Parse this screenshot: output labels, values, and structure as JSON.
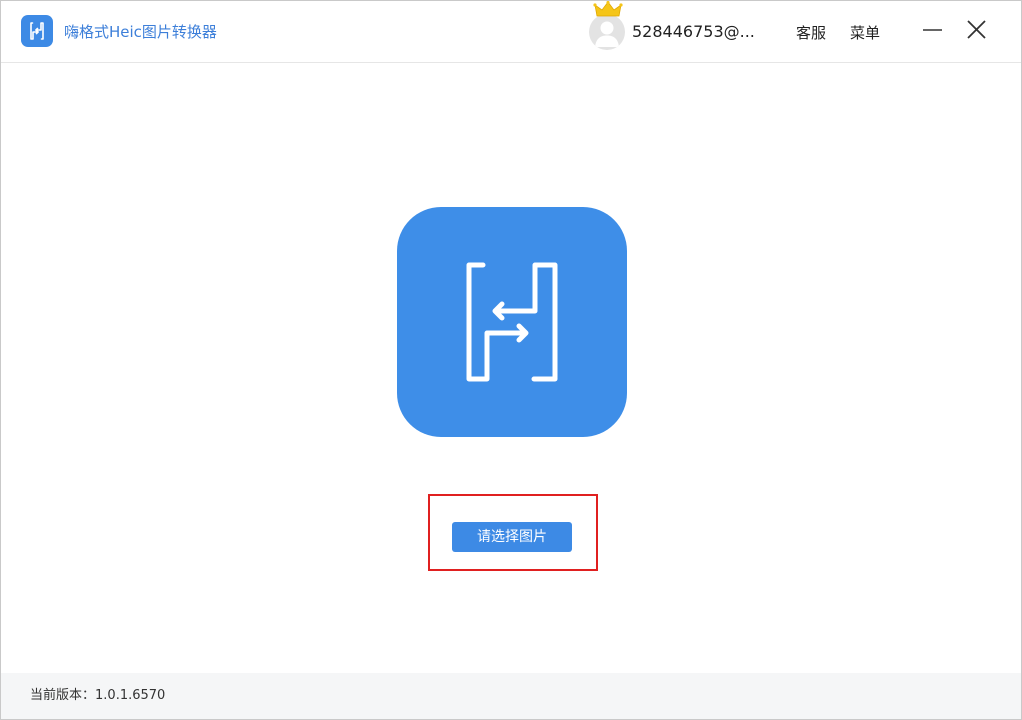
{
  "titlebar": {
    "app_title": "嗨格式Heic图片转换器",
    "app_icon": "app-logo-icon",
    "username": "528446753@...",
    "avatar_icon": "user-avatar-icon",
    "vip_icon": "crown-icon",
    "service_label": "客服",
    "menu_label": "菜单",
    "minimize_icon": "minimize-icon",
    "close_icon": "close-icon"
  },
  "main": {
    "logo_icon": "heic-converter-logo-icon",
    "select_button_label": "请选择图片"
  },
  "footer": {
    "version_label": "当前版本：",
    "version_value": "1.0.1.6570"
  },
  "colors": {
    "brand_blue": "#3d8ae5",
    "title_blue": "#3d7fd9",
    "highlight_red": "#e02020",
    "footer_bg": "#f5f6f7",
    "crown_gold": "#f5c518"
  }
}
